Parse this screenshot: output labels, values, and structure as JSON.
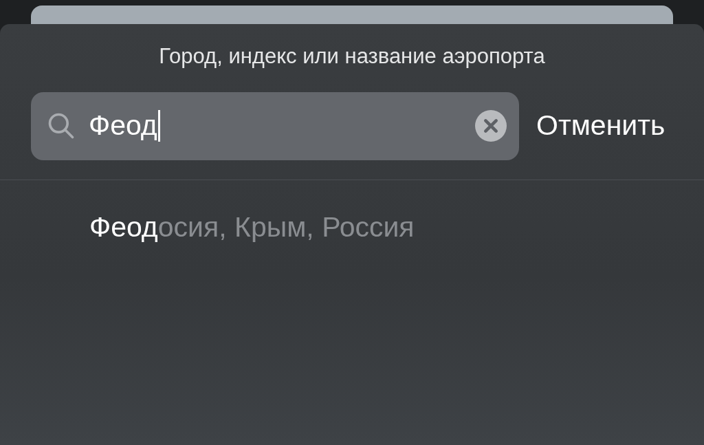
{
  "sheet": {
    "title": "Город, индекс или название аэропорта"
  },
  "search": {
    "value": "Феод",
    "cancel": "Отменить"
  },
  "results": [
    {
      "match": "Феод",
      "rest": "осия, Крым, Россия"
    }
  ]
}
